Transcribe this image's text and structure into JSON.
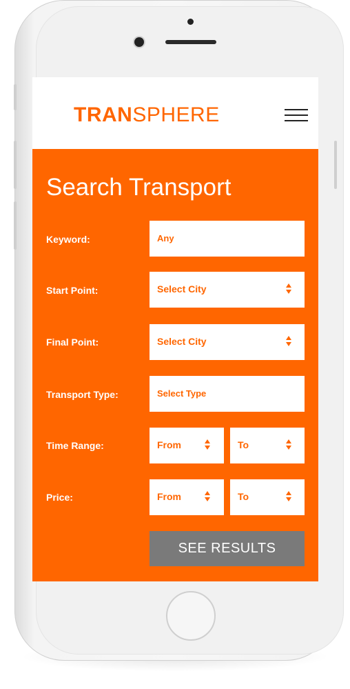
{
  "header": {
    "logo_bold": "TRAN",
    "logo_thin": "SPHERE"
  },
  "search": {
    "title": "Search Transport",
    "keyword": {
      "label": "Keyword:",
      "value": "Any"
    },
    "start_point": {
      "label": "Start Point:",
      "value": "Select City"
    },
    "final_point": {
      "label": "Final Point:",
      "value": "Select City"
    },
    "transport_type": {
      "label": "Transport Type:",
      "value": "Select Type"
    },
    "time_range": {
      "label": "Time Range:",
      "from": "From",
      "to": "To"
    },
    "price": {
      "label": "Price:",
      "from": "From",
      "to": "To"
    },
    "submit_label": "SEE RESULTS"
  },
  "colors": {
    "accent": "#ff6600",
    "button": "#7a7a7a",
    "text_on_accent": "#ffffff"
  },
  "icons": [
    "hamburger-menu-icon",
    "select-arrows-icon"
  ]
}
